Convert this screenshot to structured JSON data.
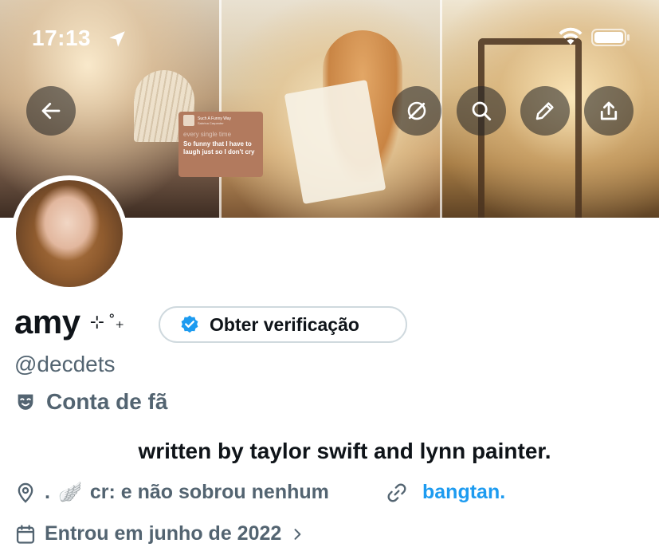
{
  "status_bar": {
    "time": "17:13"
  },
  "banner": {
    "lyric_card": {
      "song": "Such A Funny Way",
      "artist": "Sabrina Carpenter",
      "faded_line": "every single time",
      "main_line": "So funny that I have to laugh just so I don't cry"
    }
  },
  "profile": {
    "display_name": "amy",
    "name_decoration": "⊹ ˚₊",
    "verify_label": "Obter verificação",
    "handle": "@decdets",
    "category": "Conta de fã",
    "bio": "written by taylor swift and lynn painter.",
    "location_prefix": ".",
    "location_wing": "🪽",
    "location": "cr: e não sobrou nenhum",
    "website": "bangtan.",
    "joined": "Entrou em junho de 2022"
  },
  "colors": {
    "text_primary": "#0f1419",
    "text_secondary": "#536471",
    "link": "#1d9bf0",
    "verified_badge": "#1d9bf0",
    "button_border": "#cfd9de"
  },
  "icons": {
    "back": "arrow-left-icon",
    "grok": "grok-icon",
    "search": "search-icon",
    "edit": "pencil-icon",
    "share": "share-icon",
    "location": "location-pin-icon",
    "link": "link-icon",
    "calendar": "calendar-icon",
    "category": "mask-icon",
    "verified": "verified-badge-icon"
  }
}
